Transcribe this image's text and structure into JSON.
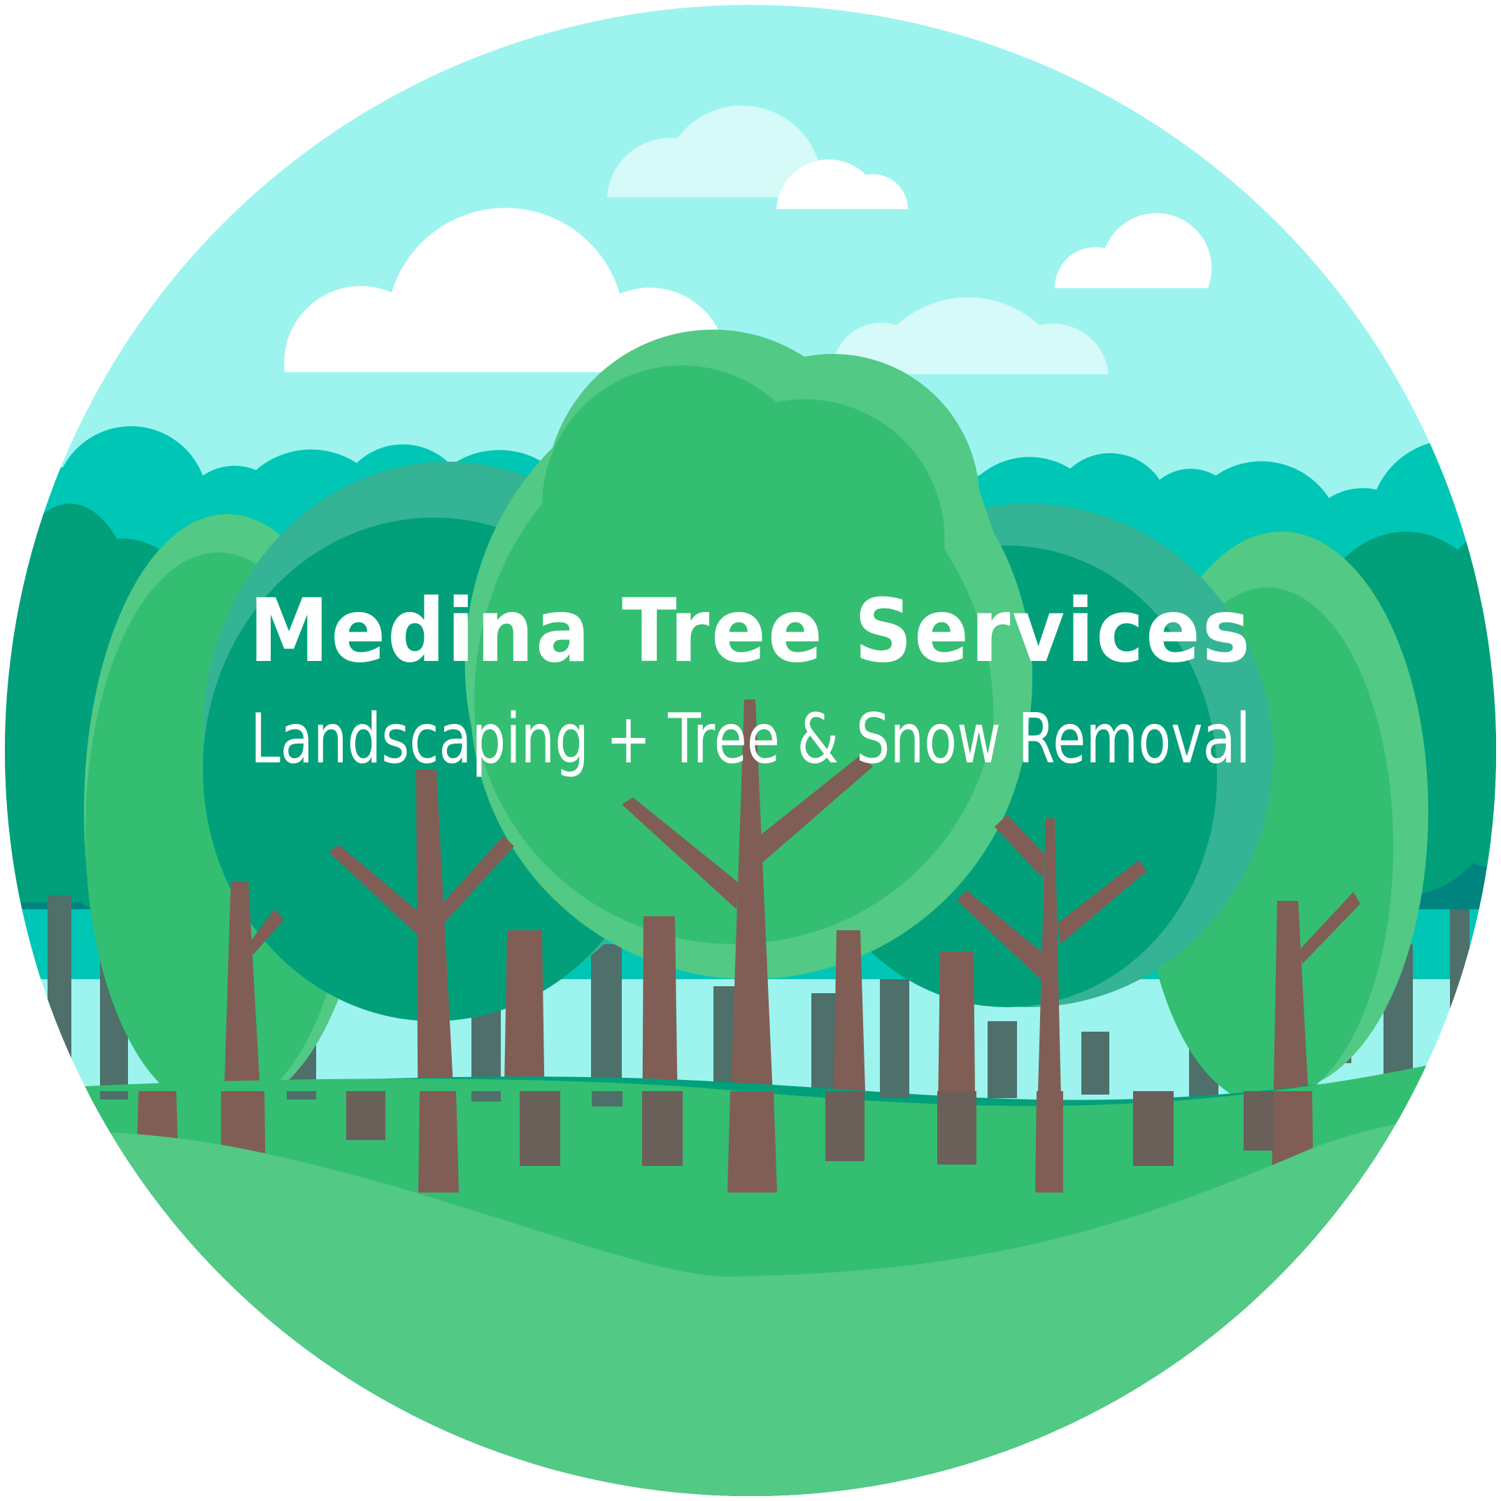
{
  "brand": {
    "name": "Medina Tree Services",
    "tagline": "Landscaping + Tree & Snow Removal"
  },
  "colors": {
    "sky": "#9DF4EF",
    "cloud_white": "#FFFFFF",
    "cloud_light": "#D5FAF8",
    "back_hills": "#00C6B6",
    "mid_forest": "#01A07A",
    "dark_forest": "#018480",
    "light_tree": "#52C985",
    "tree_green": "#34BE72",
    "teal_tree": "#35B395",
    "trunk": "#805E56",
    "trunk_dark": "#6B5F5A",
    "trunk_teal": "#4E6F6A",
    "ground_light": "#52C985",
    "ground": "#34BE72"
  }
}
